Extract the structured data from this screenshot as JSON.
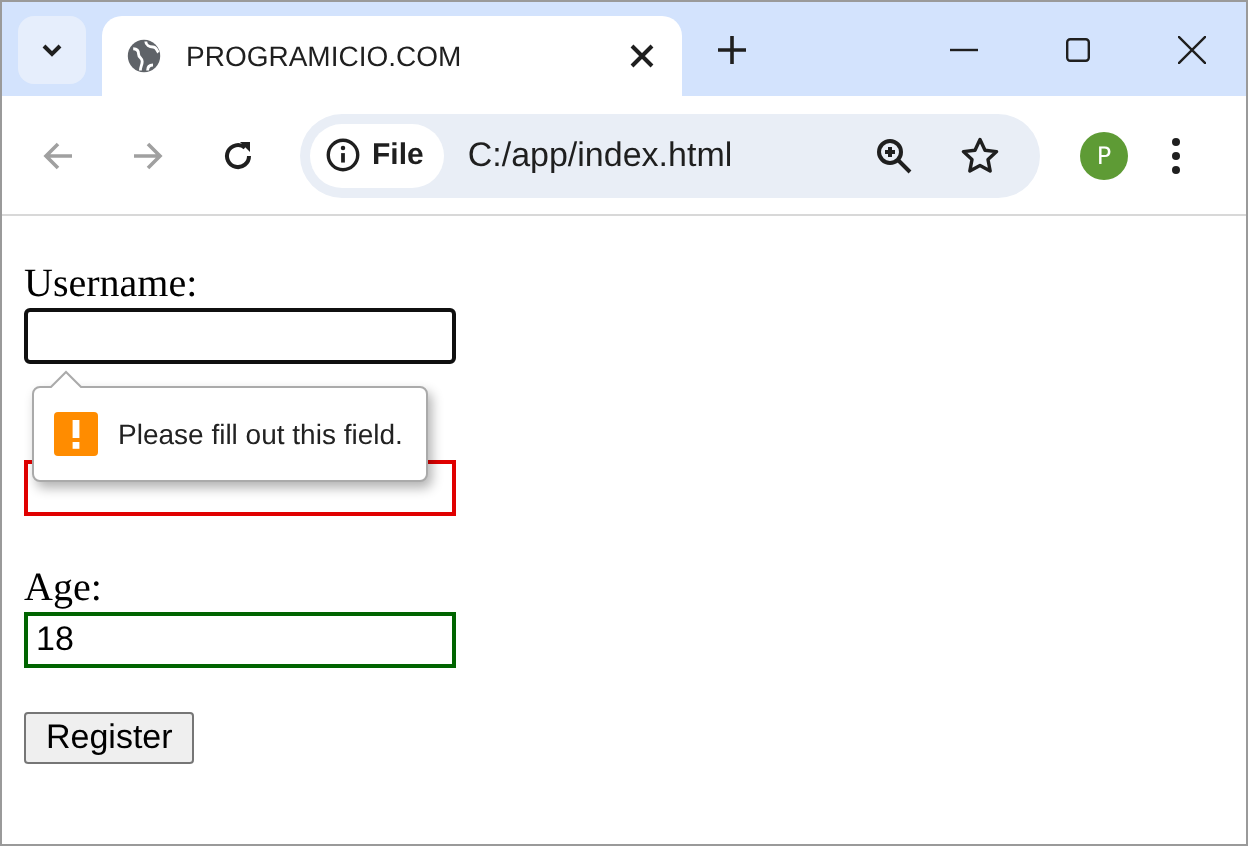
{
  "tab": {
    "title": "PROGRAMICIO.COM",
    "selected": true
  },
  "address_bar": {
    "chip": "File",
    "url": "C:/app/index.html"
  },
  "profile": {
    "initial": "P"
  },
  "form": {
    "fields": [
      {
        "label": "Username:",
        "focused": true,
        "valid": false
      },
      {
        "focused": false,
        "valid": false
      },
      {
        "label": "Age:",
        "value": "18",
        "focused": false,
        "valid": true
      }
    ],
    "submit": "Register"
  },
  "tooltip": {
    "message": "Please fill out this field."
  }
}
